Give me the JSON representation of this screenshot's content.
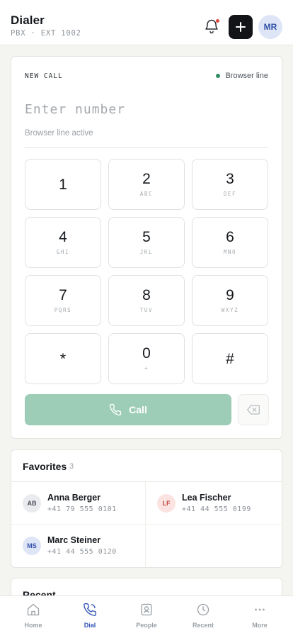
{
  "header": {
    "title": "Dialer",
    "subtitle": "PBX · EXT 1002",
    "has_notification": true,
    "add_icon": "plus-icon",
    "user_initials": "MR"
  },
  "dialer": {
    "section_label": "NEW CALL",
    "line_status": "Browser line",
    "line_status_color": "#2f8f62",
    "number_placeholder": "Enter number",
    "number_value": "",
    "line_hint": "Browser line active",
    "keys": [
      {
        "digit": "1",
        "letters": ""
      },
      {
        "digit": "2",
        "letters": "ABC"
      },
      {
        "digit": "3",
        "letters": "DEF"
      },
      {
        "digit": "4",
        "letters": "GHI"
      },
      {
        "digit": "5",
        "letters": "JKL"
      },
      {
        "digit": "6",
        "letters": "MNO"
      },
      {
        "digit": "7",
        "letters": "PQRS"
      },
      {
        "digit": "8",
        "letters": "TUV"
      },
      {
        "digit": "9",
        "letters": "WXYZ"
      },
      {
        "digit": "*",
        "letters": ""
      },
      {
        "digit": "0",
        "letters": "+"
      },
      {
        "digit": "#",
        "letters": ""
      }
    ],
    "call_label": "Call",
    "call_color": "#9ecdb7"
  },
  "favorites": {
    "title": "Favorites",
    "count": "3",
    "items": [
      {
        "initials": "AB",
        "name": "Anna Berger",
        "phone": "+41 79 555 0101",
        "avatar_bg": "#e9ebef",
        "avatar_fg": "#4a5058"
      },
      {
        "initials": "LF",
        "name": "Lea Fischer",
        "phone": "+41 44 555 0199",
        "avatar_bg": "#fbe3e1",
        "avatar_fg": "#c2453b"
      },
      {
        "initials": "MS",
        "name": "Marc Steiner",
        "phone": "+41 44 555 0120",
        "avatar_bg": "#dde5f7",
        "avatar_fg": "#3352a8"
      }
    ]
  },
  "recent": {
    "title": "Recent"
  },
  "nav": {
    "active": "Dial",
    "accent": "#2f52b4",
    "items": [
      {
        "label": "Home",
        "icon": "home-icon"
      },
      {
        "label": "Dial",
        "icon": "phone-icon"
      },
      {
        "label": "People",
        "icon": "contact-card-icon"
      },
      {
        "label": "Recent",
        "icon": "clock-icon"
      },
      {
        "label": "More",
        "icon": "more-dots-icon"
      }
    ]
  }
}
